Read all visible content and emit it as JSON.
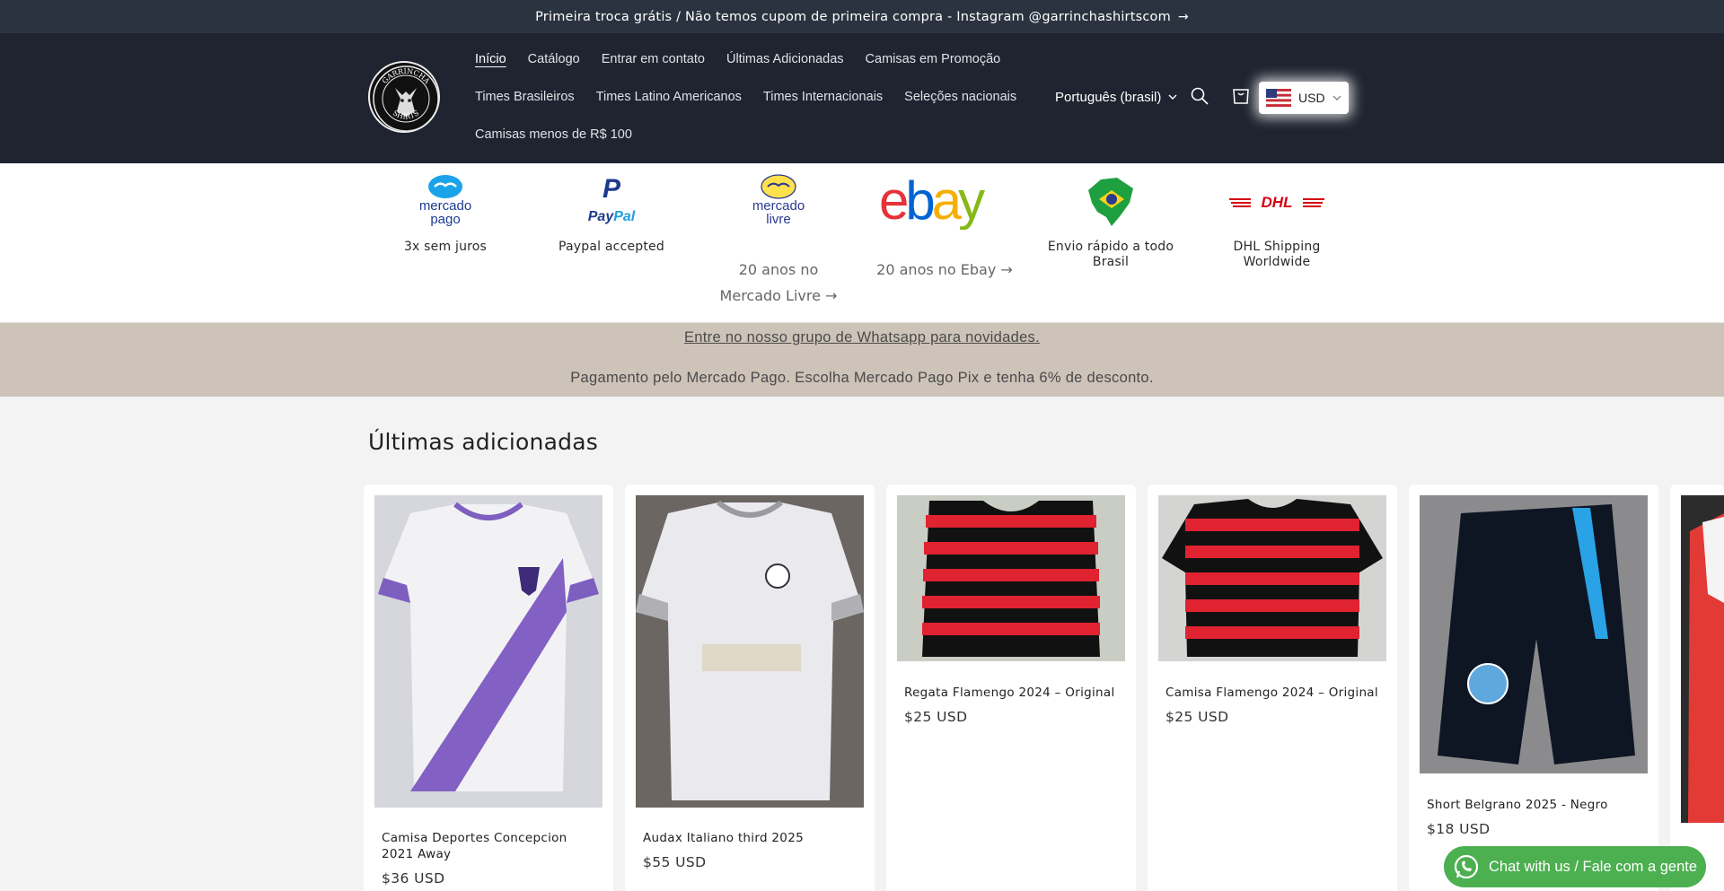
{
  "announcement": {
    "text": "Primeira troca grátis / Não temos cupom de primeira compra - Instagram @garrinchashirtscom",
    "arrow": "→"
  },
  "header": {
    "logo_text": [
      "GARRINCHA",
      "SHIRTS"
    ],
    "nav": {
      "row1": [
        "Início",
        "Catálogo",
        "Entrar em contato",
        "Últimas Adicionadas",
        "Camisas em Promoção"
      ],
      "row2": [
        "Times Brasileiros",
        "Times Latino Americanos",
        "Times Internacionais",
        "Seleções nacionais"
      ],
      "row3": [
        "Camisas menos de R$ 100"
      ]
    },
    "language": "Português (brasil)",
    "currency": "USD",
    "icons": [
      "search-icon",
      "cart-icon",
      "us-flag-icon"
    ]
  },
  "payments": {
    "items": [
      {
        "logo": "mercado pago",
        "caption": "3x sem juros"
      },
      {
        "logo": "PayPal",
        "caption": "Paypal accepted"
      },
      {
        "logo": "mercado livre",
        "link": "20 anos no Mercado Livre →"
      },
      {
        "logo": "ebay",
        "link": "20 anos no Ebay →"
      },
      {
        "logo": "brazil-map",
        "caption": "Envio rápido a todo Brasil"
      },
      {
        "logo": "DHL",
        "caption": "DHL Shipping Worldwide"
      }
    ]
  },
  "band": {
    "line1": "Entre no nosso grupo de Whatsapp para novidades.",
    "line2": "Pagamento pelo Mercado Pago. Escolha Mercado Pago Pix e tenha 6% de desconto."
  },
  "section": {
    "title": "Últimas adicionadas",
    "products": [
      {
        "title": "Camisa Deportes Concepcion 2021 Away",
        "price": "$36 USD"
      },
      {
        "title": "Audax Italiano third 2025",
        "price": "$55 USD"
      },
      {
        "title": "Regata Flamengo 2024 – Original",
        "price": "$25 USD"
      },
      {
        "title": "Camisa Flamengo 2024 – Original",
        "price": "$25 USD"
      },
      {
        "title": "Short Belgrano 2025 - Negro",
        "price": "$18 USD"
      }
    ]
  },
  "chat": {
    "label": "Chat with us / Fale com a gente"
  },
  "colors": {
    "header": "#1f2430",
    "announce": "#2b3340",
    "band": "#cec3b8",
    "chat": "#4caf50"
  }
}
